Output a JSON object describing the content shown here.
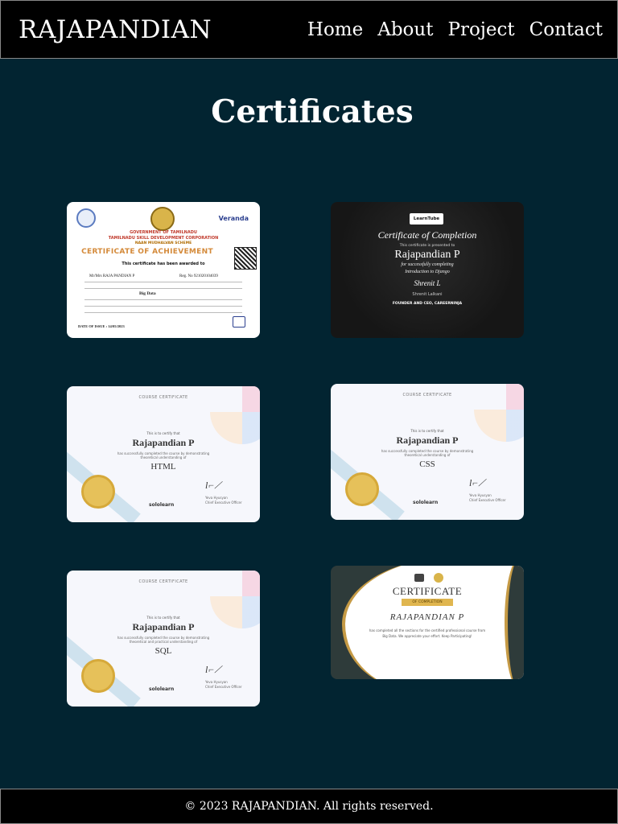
{
  "header": {
    "brand": "RAJAPANDIAN",
    "nav": [
      "Home",
      "About",
      "Project",
      "Contact"
    ]
  },
  "page": {
    "title": "Certificates"
  },
  "certificates": [
    {
      "id": "tn",
      "top_org": "GOVERNMENT OF TAMILNADU",
      "org": "TAMILNADU SKILL DEVELOPMENT CORPORATION",
      "scheme": "NAAN MUDHALVAN SCHEME",
      "title": "CERTIFICATE OF ACHIEVEMENT",
      "awarded": "This certificate has been awarded to",
      "name": "RAJA PANDIAN P",
      "reg": "921020104039",
      "course": "Big Data",
      "date": "DATE OF ISSUE : 14/05/2023",
      "brand": "Veranda"
    },
    {
      "id": "learntube",
      "logo": "LearnTube",
      "title": "Certificate of Completion",
      "presented": "This certificate is presented to",
      "name": "Rajapandian P",
      "for": "for successfully completing",
      "course": "Introduction to Django",
      "signer": "Shrenit Lalkani",
      "role": "FOUNDER AND CEO, CAREERNINJA"
    },
    {
      "id": "html",
      "header": "COURSE CERTIFICATE",
      "certify": "This is to certify that",
      "name": "Rajapandian P",
      "desc": "has successfully completed the course by demonstrating theoretical understanding of",
      "course": "HTML",
      "brand": "sololearn",
      "signer": "Yeva Hyusyan",
      "role": "Chief Executive Officer"
    },
    {
      "id": "css",
      "header": "COURSE CERTIFICATE",
      "certify": "This is to certify that",
      "name": "Rajapandian P",
      "desc": "has successfully completed the course by demonstrating theoretical understanding of",
      "course": "CSS",
      "brand": "sololearn",
      "signer": "Yeva Hyusyan",
      "role": "Chief Executive Officer"
    },
    {
      "id": "sql",
      "header": "COURSE CERTIFICATE",
      "certify": "This is to certify that",
      "name": "Rajapandian P",
      "desc": "has successfully completed the course by demonstrating theoretical and practical understanding of",
      "course": "SQL",
      "brand": "sololearn",
      "signer": "Yeva Hyusyan",
      "role": "Chief Executive Officer"
    },
    {
      "id": "guvi",
      "title": "CERTIFICATE",
      "ribbon": "OF COMPLETION",
      "name": "RAJAPANDIAN P",
      "line1": "has completed all the sections for the certified professional course from",
      "line2": "Big Data. We appreciate your effort. Keep Participating!"
    }
  ],
  "footer": {
    "text": "© 2023 RAJAPANDIAN. All rights reserved."
  },
  "colors": {
    "background": "#022431",
    "bar": "#000000",
    "sololearn_accent": "#f4c430",
    "guvi_gold": "#c59a45"
  }
}
